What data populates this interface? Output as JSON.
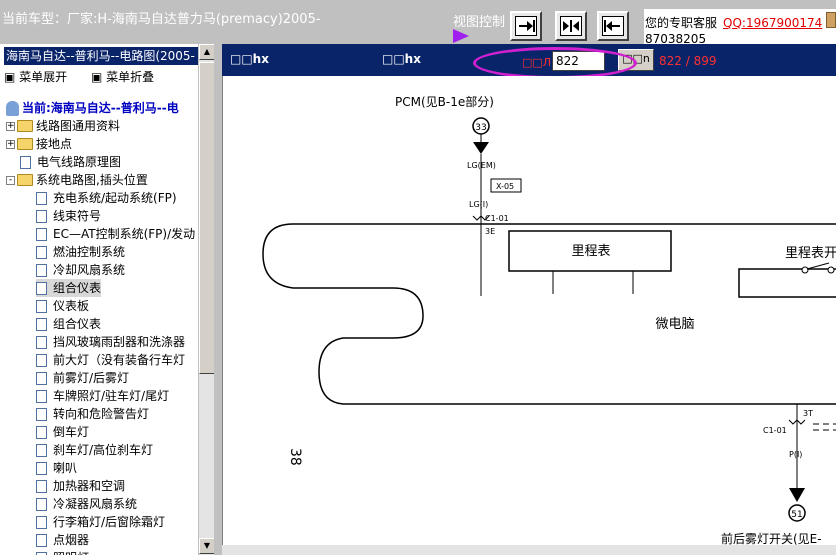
{
  "header": {
    "car_type": "当前车型：厂家:H-海南马自达普力马(premacy)2005-",
    "view_control_label": "视图控制",
    "view_buttons": [
      "fit-width",
      "fit-both",
      "fit-height"
    ],
    "support_text": "您的专职客服",
    "support_qq": "QQ:1967900174",
    "support_phone": "87038205"
  },
  "left_panel": {
    "title": "海南马自达--普利马--电路图(2005-",
    "expand_label": "菜单展开",
    "collapse_label": "菜单折叠",
    "tree": [
      {
        "label": "当前:海南马自达--普利马--电",
        "type": "root"
      },
      {
        "label": "线路图通用资料",
        "type": "folder",
        "expander": "+"
      },
      {
        "label": "接地点",
        "type": "folder",
        "expander": "+"
      },
      {
        "label": "电气线路原理图",
        "type": "doc"
      },
      {
        "label": "系统电路图,插头位置",
        "type": "folder-open",
        "expander": "-"
      },
      {
        "label": "充电系统/起动系统(FP)",
        "type": "doc"
      },
      {
        "label": "线束符号",
        "type": "doc"
      },
      {
        "label": "EC—AT控制系统(FP)/发动",
        "type": "doc"
      },
      {
        "label": "燃油控制系统",
        "type": "doc"
      },
      {
        "label": "冷却风扇系统",
        "type": "doc"
      },
      {
        "label": "组合仪表",
        "type": "doc",
        "selected": true
      },
      {
        "label": "仪表板",
        "type": "doc"
      },
      {
        "label": "组合仪表",
        "type": "doc"
      },
      {
        "label": "挡风玻璃雨刮器和洗涤器",
        "type": "doc"
      },
      {
        "label": "前大灯（没有装备行车灯",
        "type": "doc"
      },
      {
        "label": "前雾灯/后雾灯",
        "type": "doc"
      },
      {
        "label": "车牌照灯/驻车灯/尾灯",
        "type": "doc"
      },
      {
        "label": "转向和危险警告灯",
        "type": "doc"
      },
      {
        "label": "倒车灯",
        "type": "doc"
      },
      {
        "label": "刹车灯/高位刹车灯",
        "type": "doc"
      },
      {
        "label": "喇叭",
        "type": "doc"
      },
      {
        "label": "加热器和空调",
        "type": "doc"
      },
      {
        "label": "冷凝器风扇系统",
        "type": "doc"
      },
      {
        "label": "行李箱灯/后窗除霜灯",
        "type": "doc"
      },
      {
        "label": "点烟器",
        "type": "doc"
      },
      {
        "label": "照明灯",
        "type": "doc"
      }
    ]
  },
  "viewer": {
    "header_left": "□□hx",
    "header_mid": "□□hx",
    "page_label": "□□Л",
    "page_value": "822",
    "go_label": "□□n",
    "page_count": "822 / 899"
  },
  "diagram": {
    "pcm_label": "PCM(见B-1e部分)",
    "node_33": "33",
    "lg_em": "LG(EM)",
    "x05": "X-05",
    "lg_i": "LG(I)",
    "c101_top": "C1-01",
    "pin_3e": "3E",
    "odometer": "里程表",
    "odometer_switch": "里程表开",
    "microcomputer": "微电脑",
    "page_number": "38",
    "pin_3t": "3T",
    "c101_bottom": "C1-01",
    "p_i": "P(I)",
    "node_51": "51",
    "fog_switch": "前后雾灯开关(见E-"
  }
}
